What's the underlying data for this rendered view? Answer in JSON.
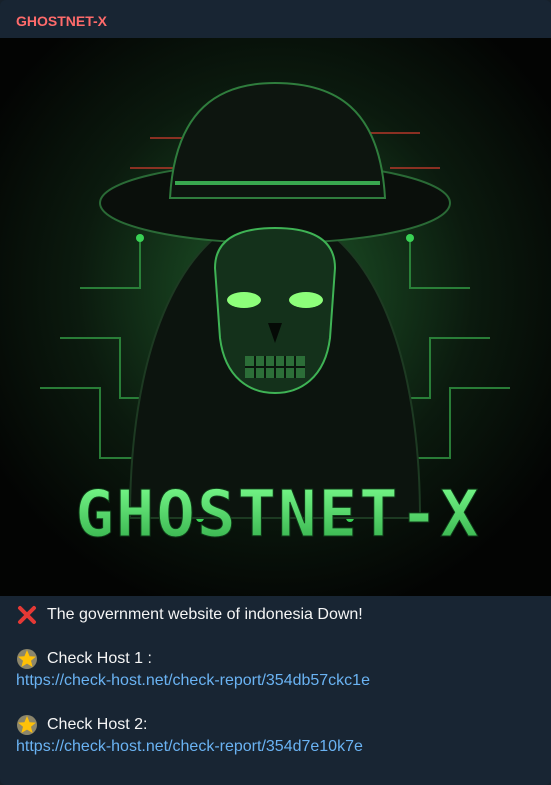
{
  "message": {
    "sender": "GHOSTNET-X",
    "image": {
      "logo_text": "GHOSTNET-X",
      "accent_color": "#3ddc5a"
    },
    "lines": [
      {
        "icon": "cross-mark-icon",
        "text": "The government website of indonesia Down!"
      },
      {
        "icon": "glowing-star-icon",
        "text": "Check Host 1 :",
        "link": "https://check-host.net/check-report/354db57ckc1e"
      },
      {
        "icon": "glowing-star-icon",
        "text": "Check Host 2:",
        "link": "https://check-host.net/check-report/354d7e10k7e"
      }
    ]
  },
  "colors": {
    "background": "#17212b",
    "sender": "#ff6b6b",
    "link": "#6ab3f3",
    "text": "#f5f5f5"
  }
}
